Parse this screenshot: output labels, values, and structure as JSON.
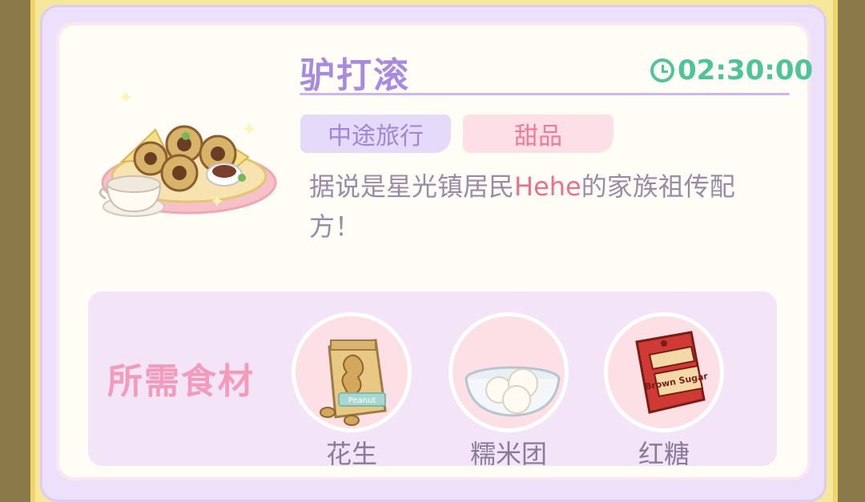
{
  "recipe": {
    "title": "驴打滚",
    "timer": "02:30:00",
    "tags": [
      "中途旅行",
      "甜品"
    ],
    "description_before": "据说是星光镇居民",
    "description_highlight": "Hehe",
    "description_after": "的家族祖传配方！"
  },
  "ingredients": {
    "title": "所需食材",
    "items": [
      {
        "name": "花生",
        "icon": "peanut-bag-icon",
        "package_text": "Peanut"
      },
      {
        "name": "糯米团",
        "icon": "rice-balls-icon"
      },
      {
        "name": "红糖",
        "icon": "brown-sugar-bag-icon",
        "package_text": "Brown Sugar"
      }
    ]
  },
  "colors": {
    "title": "#a88be0",
    "timer": "#4ec49a",
    "highlight": "#ee6f8c",
    "ingredient_title": "#f39bbb"
  }
}
